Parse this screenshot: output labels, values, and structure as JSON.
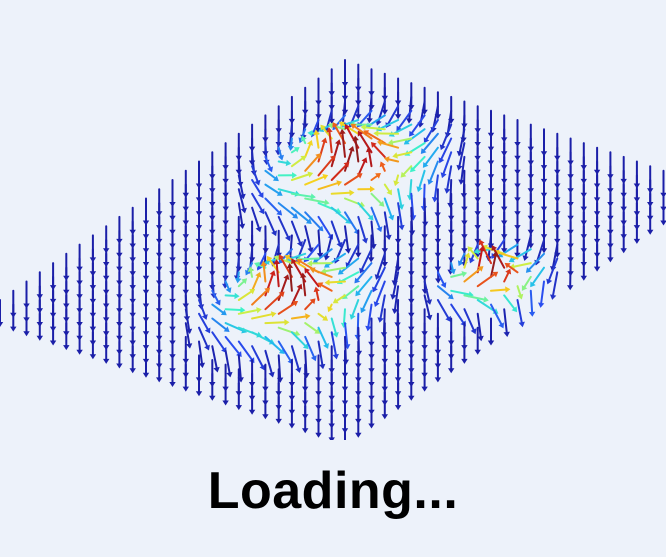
{
  "loading": {
    "text": "Loading..."
  },
  "visual": {
    "name": "spin-texture-vector-field",
    "colormap": [
      "#1b1fa8",
      "#2a4df0",
      "#23b8ef",
      "#3ef2c9",
      "#c8f24a",
      "#f5d21f",
      "#f0621c",
      "#c8181a",
      "#8c1c1c"
    ]
  }
}
